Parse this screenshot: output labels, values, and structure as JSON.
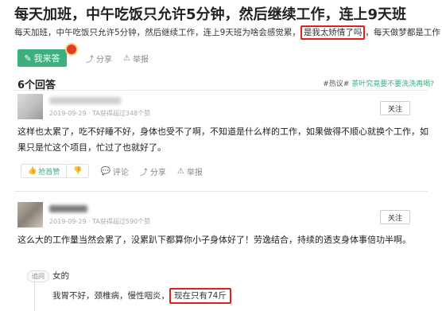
{
  "question": {
    "title": "每天加班，中午吃饭只允许5分钟，然后继续工作，连上9天班",
    "desc_before": "每天加班，中午吃饭只允许5分钟，然后继续工作，连上9天班为啥会感觉累，",
    "desc_highlight": "是我太矫情了吗",
    "desc_after": "，每天做梦都是工作",
    "answer_button": "我来答",
    "share": "分享",
    "report": "举报"
  },
  "answers_header": {
    "count": "6个回答",
    "hot_tag": "#热议#",
    "hot_link": "茶叶究竟要不要洗洗再喝?"
  },
  "answer1": {
    "meta": "2019-09-29 · TA获得超过348个赞",
    "follow": "关注",
    "text": "这样也太累了，吃不好睡不好，身体也受不了啊，不知道是什么样的工作，如果做得不顺心就换个工作，如果只是忙这个项目，忙过了也就好了。",
    "upvote": "抢首赞",
    "comment": "评论",
    "share": "分享",
    "report": "举报"
  },
  "answer2": {
    "meta": "2019-09-29 · TA获得超过590个赞",
    "follow": "关注",
    "text": "这么大的工作量当然会累了，没累趴下都算你小子身体好了！劳逸结合，持续的透支身体事倍功半啊。",
    "reply_tag": "追问",
    "reply_question": "女的",
    "reply_answer_before": "我胃不好，颈椎病，慢性咽炎，",
    "reply_answer_highlight": "现在只有74斤"
  },
  "colors": {
    "accent": "#3eaf7c",
    "highlight_box": "#e02020"
  }
}
